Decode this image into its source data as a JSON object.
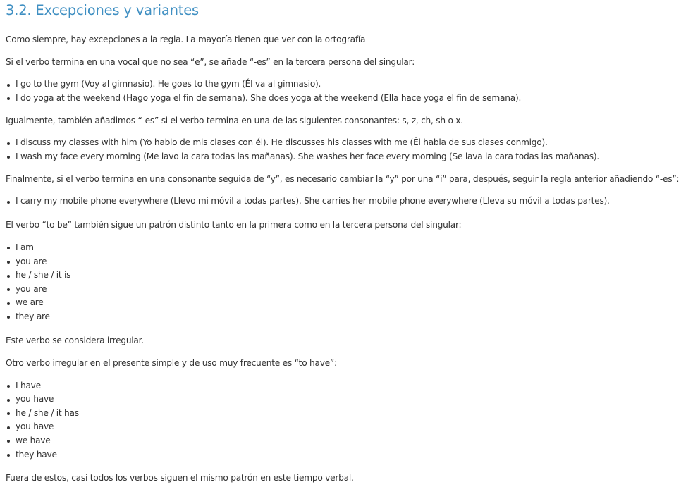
{
  "heading": "3.2. Excepciones y variantes",
  "intro": "Como siempre, hay excepciones a la regla. La mayoría tienen que ver con la ortografía",
  "vowel_rule": "Si el verbo termina en una vocal que no sea “e”, se añade “-es” en la tercera persona del singular:",
  "vowel_examples": [
    "I go to the gym (Voy al gimnasio). He goes to the gym (Él va al gimnasio).",
    "I do yoga at the weekend (Hago yoga el fin de semana). She does yoga at the weekend (Ella hace yoga el fin de semana)."
  ],
  "consonant_rule": "Igualmente, también añadimos “-es” si el verbo termina en una de las siguientes consonantes: s, z, ch, sh o x.",
  "consonant_examples": [
    "I discuss my classes with him (Yo hablo de mis clases con él). He discusses his classes with me (Él habla de sus clases conmigo).",
    "I wash my face every morning (Me lavo la cara todas las mañanas). She washes her face every morning (Se lava la cara todas las mañanas)."
  ],
  "y_rule": "Finalmente, si el verbo termina en una consonante seguida de “y”, es necesario cambiar la “y” por una “i” para, después, seguir la regla anterior añadiendo “-es”:",
  "y_examples": [
    "I carry my mobile phone everywhere (Llevo mi móvil a todas partes). She carries her mobile phone everywhere (Lleva su móvil a todas partes)."
  ],
  "to_be_intro": "El verbo “to be” también sigue un patrón distinto tanto en la primera como en la tercera persona del singular:",
  "to_be_forms": [
    "I am",
    "you are",
    "he / she / it is",
    "you are",
    "we are",
    "they are"
  ],
  "to_be_note": "Este verbo se considera irregular.",
  "to_have_intro": "Otro verbo irregular en el presente simple y de uso muy frecuente es “to have”:",
  "to_have_forms": [
    "I have",
    "you have",
    "he / she / it has",
    "you have",
    "we have",
    "they have"
  ],
  "conclusion": "Fuera de estos, casi todos los verbos siguen el mismo patrón en este tiempo verbal."
}
